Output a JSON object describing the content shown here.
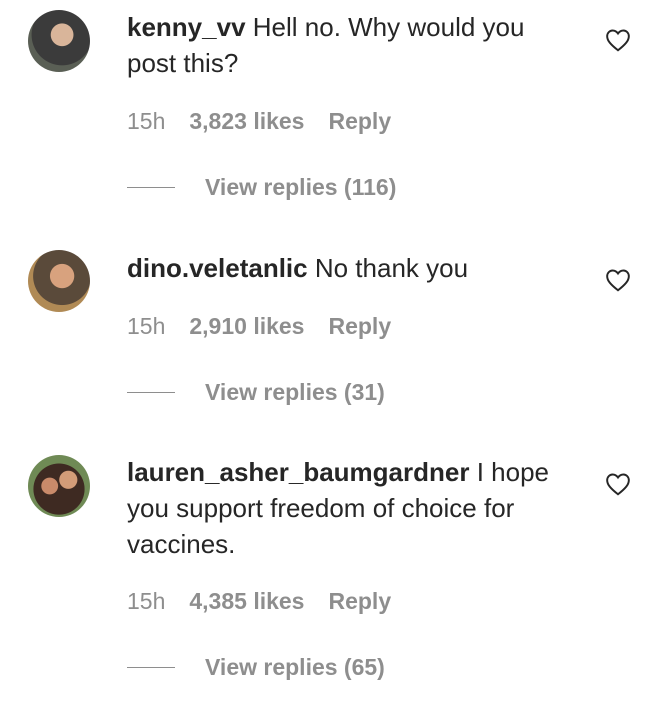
{
  "comments": [
    {
      "username": "kenny_vv",
      "text": "Hell no. Why would you post this?",
      "time": "15h",
      "likes": "3,823 likes",
      "reply": "Reply",
      "view_replies": "View replies (116)"
    },
    {
      "username": "dino.veletanlic",
      "text": "No thank you",
      "time": "15h",
      "likes": "2,910 likes",
      "reply": "Reply",
      "view_replies": "View replies (31)"
    },
    {
      "username": "lauren_asher_baumgardner",
      "text": "I hope you support freedom of choice for vaccines.",
      "time": "15h",
      "likes": "4,385 likes",
      "reply": "Reply",
      "view_replies": "View replies (65)"
    }
  ],
  "icons": {
    "like": "heart-outline-icon"
  },
  "colors": {
    "text": "#262626",
    "muted": "#8e8e8e",
    "background": "#ffffff"
  }
}
